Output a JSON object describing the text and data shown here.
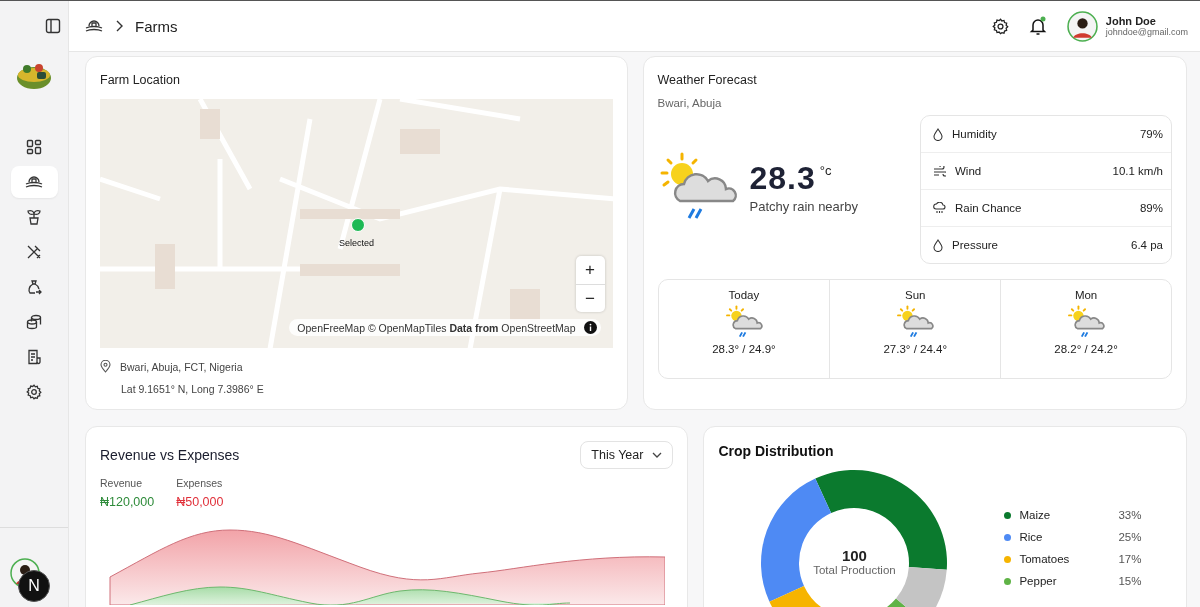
{
  "sidebar": {
    "nav": [
      {
        "kind": "dashboard",
        "selected": false
      },
      {
        "kind": "farm",
        "selected": true
      },
      {
        "kind": "plant",
        "selected": false
      },
      {
        "kind": "tools",
        "selected": false
      },
      {
        "kind": "bag",
        "selected": false
      },
      {
        "kind": "coins",
        "selected": false
      },
      {
        "kind": "report",
        "selected": false
      },
      {
        "kind": "settings",
        "selected": false
      }
    ],
    "badge": "N"
  },
  "header": {
    "breadcrumb": "Farms",
    "user": {
      "name": "John Doe",
      "email": "johndoe@gmail.com"
    },
    "notification_unread": true
  },
  "farm_location": {
    "title": "Farm Location",
    "marker_label": "Selected",
    "zoom_in": "+",
    "zoom_out": "−",
    "attribution": "OpenFreeMap © OpenMapTiles **Data from** OpenStreetMap",
    "address": "Bwari, Abuja, FCT, Nigeria",
    "coordinates": "Lat 9.1651° N, Long 7.3986° E"
  },
  "weather": {
    "title": "Weather Forecast",
    "location": "Bwari, Abuja",
    "temperature": "28.3",
    "unit": "°c",
    "condition": "Patchy rain nearby",
    "details": [
      {
        "kind": "drop",
        "label": "Humidity",
        "value": "79%"
      },
      {
        "kind": "wind",
        "label": "Wind",
        "value": "10.1 km/h"
      },
      {
        "kind": "rain",
        "label": "Rain Chance",
        "value": "89%"
      },
      {
        "kind": "drop",
        "label": "Pressure",
        "value": "6.4 pa"
      }
    ],
    "forecast": [
      {
        "day": "Today",
        "temps": "28.3° / 24.9°"
      },
      {
        "day": "Sun",
        "temps": "27.3° / 24.4°"
      },
      {
        "day": "Mon",
        "temps": "28.2° / 24.2°"
      }
    ]
  },
  "revenue": {
    "title": "Revenue vs Expenses",
    "period": "This Year",
    "stats": [
      {
        "kind": "revenue",
        "label": "Revenue",
        "value": "₦120,000"
      },
      {
        "kind": "expense",
        "label": "Expenses",
        "value": "₦50,000"
      }
    ]
  },
  "crops": {
    "title": "Crop Distribution",
    "total": "100",
    "total_label": "Total Production",
    "chart_data": {
      "type": "donut",
      "categories": [
        "Maize",
        "Rice",
        "Tomatoes",
        "Pepper",
        null
      ],
      "values": [
        33,
        25,
        17,
        15,
        10
      ]
    },
    "legend": [
      {
        "value": "33%",
        "color": "#0b7a2e"
      },
      {
        "value": "25%",
        "color": "#4e8af4"
      },
      {
        "value": "17%",
        "color": "#f6b400"
      },
      {
        "value": "15%",
        "color": "#5fb346"
      }
    ]
  }
}
